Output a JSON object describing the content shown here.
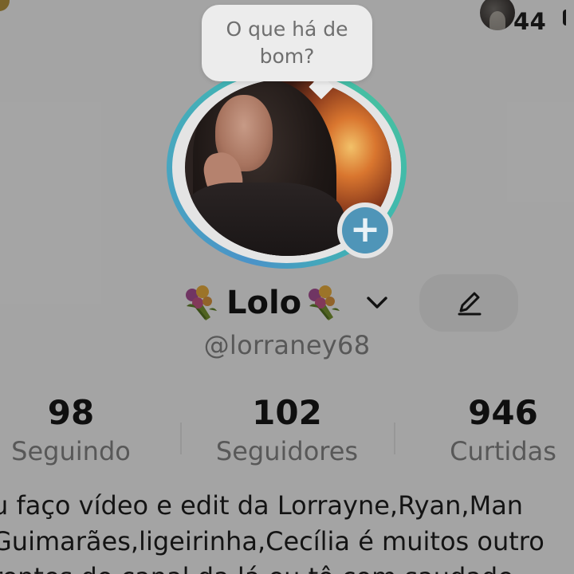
{
  "notifications": {
    "count": "44"
  },
  "story_bubble": {
    "text_line1": "O que há de",
    "text_line2": "bom?"
  },
  "profile": {
    "display_name": "Lolo",
    "username": "@lorraney68",
    "ring_colors": [
      "#4a93c8",
      "#3fb7b0",
      "#46bfa1"
    ],
    "plus_color": "#4f95b8"
  },
  "stats": [
    {
      "value": "98",
      "label": "Seguindo"
    },
    {
      "value": "102",
      "label": "Seguidores"
    },
    {
      "value": "946",
      "label": "Curtidas"
    }
  ],
  "bio": {
    "lines": [
      "u faço vídeo e edit da Lorrayne,Ryan,Man",
      "Guimarães,ligeirinha,Cecília é muitos outro",
      "rentes do canal da lá eu tô com saudade"
    ]
  },
  "icons": {
    "avatar_add": "plus-icon",
    "name_menu": "chevron-down-icon",
    "edit": "pencil-icon",
    "decoration": "bouquet-emoji"
  }
}
